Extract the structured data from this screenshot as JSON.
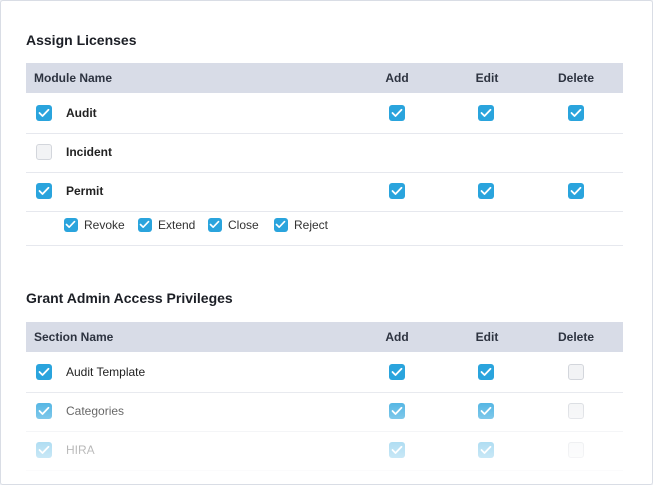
{
  "licenses": {
    "title": "Assign Licenses",
    "headers": {
      "name": "Module Name",
      "add": "Add",
      "edit": "Edit",
      "delete": "Delete"
    },
    "rows": [
      {
        "label": "Audit",
        "checked": true,
        "add": true,
        "edit": true,
        "delete": true
      },
      {
        "label": "Incident",
        "checked": false,
        "add": null,
        "edit": null,
        "delete": null
      },
      {
        "label": "Permit",
        "checked": true,
        "add": true,
        "edit": true,
        "delete": true
      }
    ],
    "permit_sub": [
      {
        "label": "Revoke",
        "checked": true
      },
      {
        "label": "Extend",
        "checked": true
      },
      {
        "label": "Close",
        "checked": true
      },
      {
        "label": "Reject",
        "checked": true
      }
    ]
  },
  "admin": {
    "title": "Grant Admin Access Privileges",
    "headers": {
      "name": "Section Name",
      "add": "Add",
      "edit": "Edit",
      "delete": "Delete"
    },
    "rows": [
      {
        "label": "Audit Template",
        "checked": true,
        "add": true,
        "edit": true,
        "delete": false
      },
      {
        "label": "Categories",
        "checked": true,
        "add": true,
        "edit": true,
        "delete": false
      },
      {
        "label": "HIRA",
        "checked": true,
        "add": true,
        "edit": true,
        "delete": false
      }
    ]
  },
  "colors": {
    "accent": "#2aa4dd",
    "header_bg": "#d8dce7"
  }
}
